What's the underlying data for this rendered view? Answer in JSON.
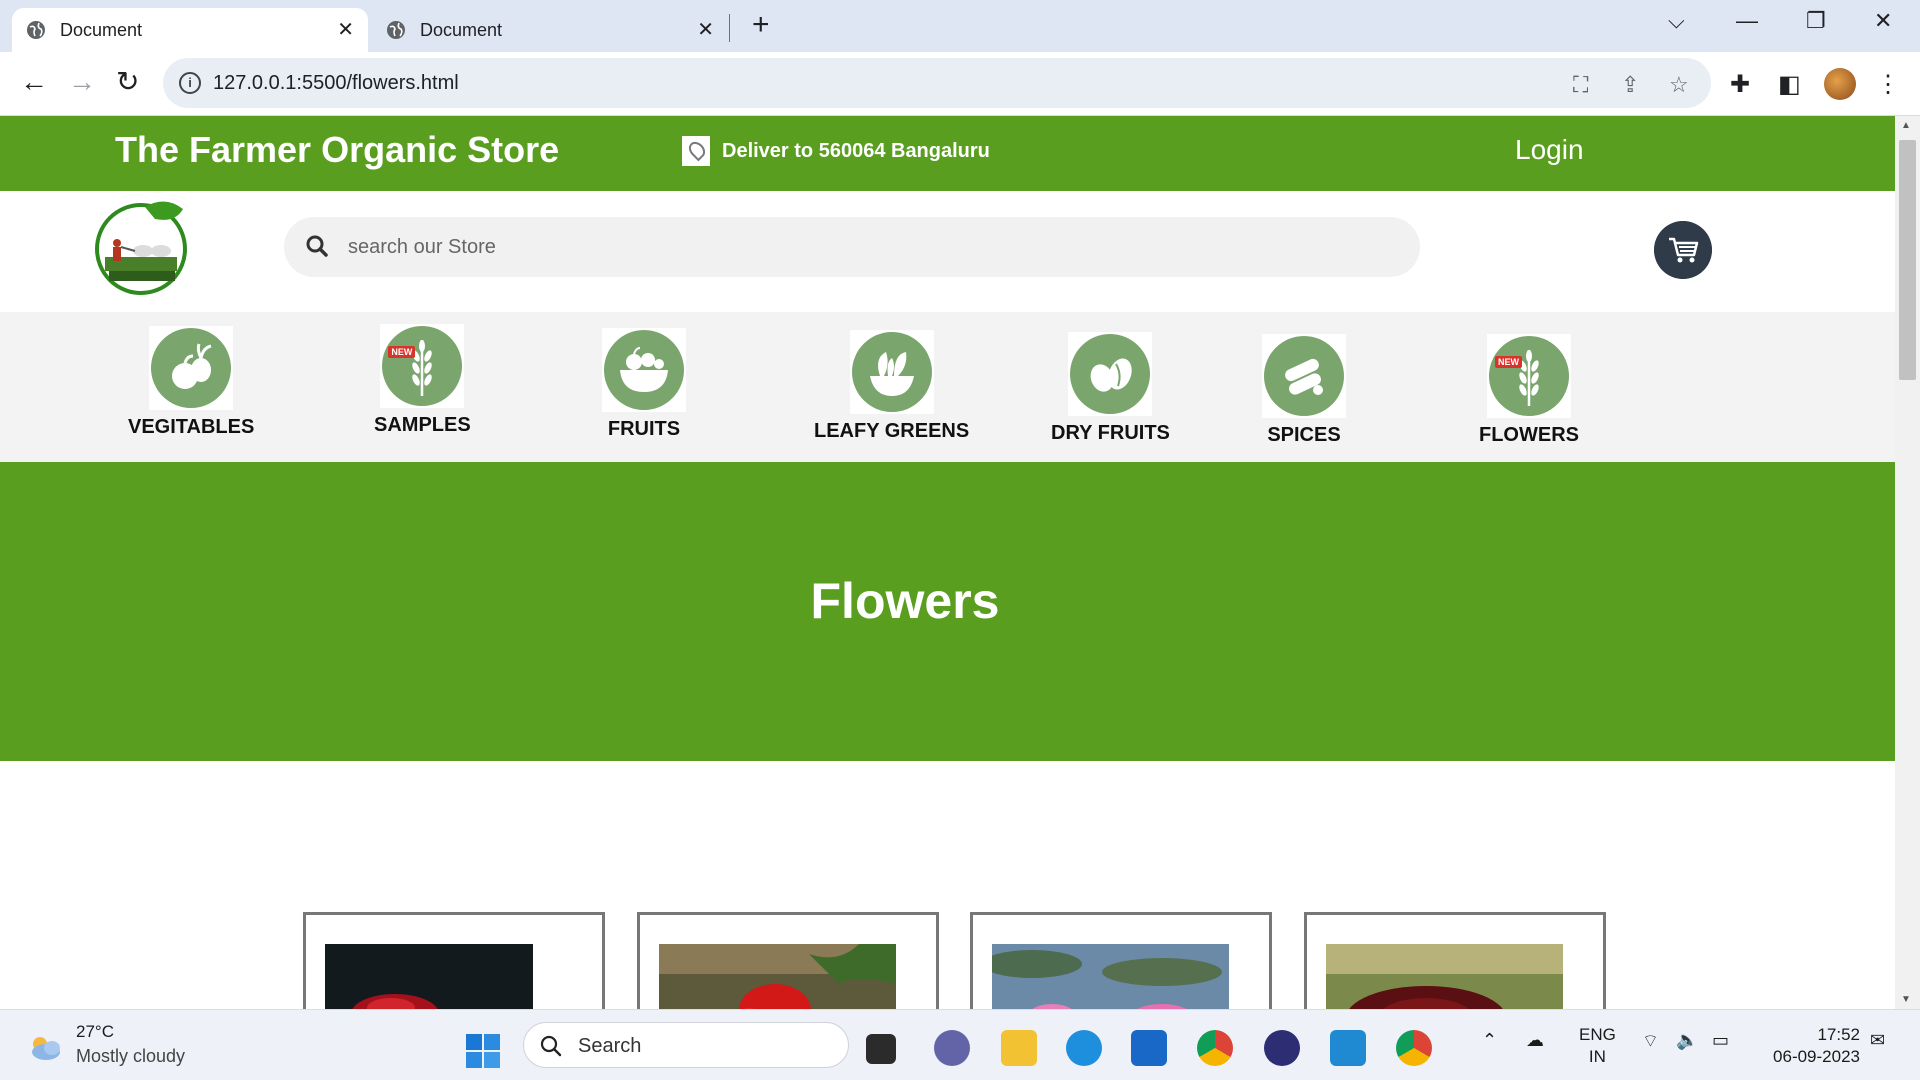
{
  "browser": {
    "tabs": [
      {
        "title": "Document",
        "active": true
      },
      {
        "title": "Document",
        "active": false
      }
    ],
    "url": "127.0.0.1:5500/flowers.html"
  },
  "site": {
    "brand": "The Farmer Organic Store",
    "deliver": "Deliver to 560064 Bangaluru",
    "login": "Login",
    "search_placeholder": "search our Store",
    "categories": [
      {
        "label": "VEGITABLES",
        "icon": "vegetables-icon",
        "new": false
      },
      {
        "label": "SAMPLES",
        "icon": "wheat-icon",
        "new": true
      },
      {
        "label": "FRUITS",
        "icon": "fruit-basket-icon",
        "new": false
      },
      {
        "label": "LEAFY GREENS",
        "icon": "leafy-bowl-icon",
        "new": false
      },
      {
        "label": "DRY FRUITS",
        "icon": "nuts-icon",
        "new": false
      },
      {
        "label": "SPICES",
        "icon": "spices-icon",
        "new": false
      },
      {
        "label": "FLOWERS",
        "icon": "wheat-icon",
        "new": true
      }
    ],
    "new_badge": "NEW",
    "page_heading": "Flowers",
    "colors": {
      "brand_green": "#5a9e20",
      "icon_green": "#7aa56d",
      "cart_dark": "#2f3b48"
    }
  },
  "taskbar": {
    "weather_temp": "27°C",
    "weather_cond": "Mostly cloudy",
    "search_label": "Search",
    "lang_line1": "ENG",
    "lang_line2": "IN",
    "time": "17:52",
    "date": "06-09-2023"
  }
}
